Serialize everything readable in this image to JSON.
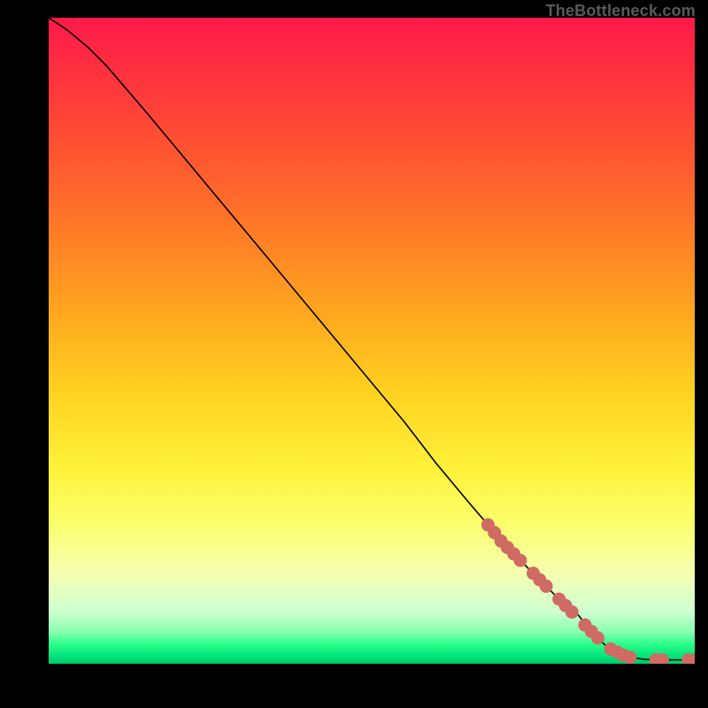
{
  "attribution": "TheBottleneck.com",
  "chart_data": {
    "type": "line",
    "title": "",
    "xlabel": "",
    "ylabel": "",
    "xlim": [
      0,
      100
    ],
    "ylim": [
      0,
      100
    ],
    "series": [
      {
        "name": "curve",
        "x": [
          0,
          3,
          6,
          9,
          12,
          15,
          20,
          25,
          30,
          35,
          40,
          45,
          50,
          55,
          60,
          65,
          68,
          70,
          72,
          74,
          76,
          78,
          80,
          82,
          84,
          86,
          88,
          90,
          92,
          94,
          96,
          98,
          100
        ],
        "y": [
          100,
          98,
          95.5,
          92.5,
          89,
          85.5,
          79.5,
          73.5,
          67.5,
          61.5,
          55.5,
          49.5,
          43.5,
          37.5,
          31,
          25,
          21.5,
          19,
          17,
          15,
          13,
          11,
          9,
          7.5,
          5,
          3,
          1.8,
          1,
          0.7,
          0.6,
          0.6,
          0.6,
          0.6
        ]
      }
    ],
    "markers": {
      "name": "highlighted-points",
      "color": "#cf6b63",
      "points": [
        {
          "x": 68,
          "y": 21.5
        },
        {
          "x": 69,
          "y": 20.3
        },
        {
          "x": 70,
          "y": 19
        },
        {
          "x": 71,
          "y": 18
        },
        {
          "x": 72,
          "y": 17
        },
        {
          "x": 73,
          "y": 16
        },
        {
          "x": 75,
          "y": 14
        },
        {
          "x": 76,
          "y": 13
        },
        {
          "x": 77,
          "y": 12
        },
        {
          "x": 79,
          "y": 10
        },
        {
          "x": 80,
          "y": 9
        },
        {
          "x": 81,
          "y": 8
        },
        {
          "x": 83,
          "y": 6
        },
        {
          "x": 84,
          "y": 5
        },
        {
          "x": 85,
          "y": 4
        },
        {
          "x": 87,
          "y": 2.3
        },
        {
          "x": 88,
          "y": 1.8
        },
        {
          "x": 89,
          "y": 1.3
        },
        {
          "x": 90,
          "y": 1
        },
        {
          "x": 94,
          "y": 0.6
        },
        {
          "x": 95,
          "y": 0.6
        },
        {
          "x": 99,
          "y": 0.6
        },
        {
          "x": 100,
          "y": 0.6
        }
      ]
    }
  }
}
